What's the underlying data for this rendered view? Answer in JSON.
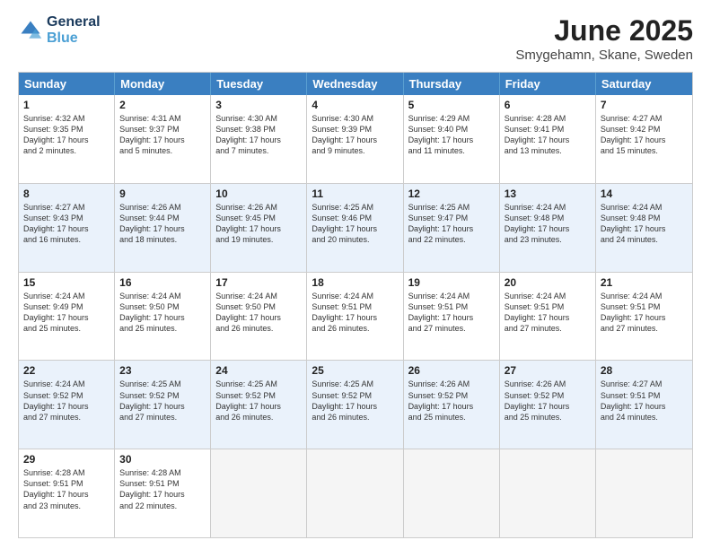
{
  "header": {
    "logo_line1": "General",
    "logo_line2": "Blue",
    "title": "June 2025",
    "subtitle": "Smygehamn, Skane, Sweden"
  },
  "calendar": {
    "days": [
      "Sunday",
      "Monday",
      "Tuesday",
      "Wednesday",
      "Thursday",
      "Friday",
      "Saturday"
    ],
    "rows": [
      [
        {
          "num": "1",
          "lines": [
            "Sunrise: 4:32 AM",
            "Sunset: 9:35 PM",
            "Daylight: 17 hours",
            "and 2 minutes."
          ]
        },
        {
          "num": "2",
          "lines": [
            "Sunrise: 4:31 AM",
            "Sunset: 9:37 PM",
            "Daylight: 17 hours",
            "and 5 minutes."
          ]
        },
        {
          "num": "3",
          "lines": [
            "Sunrise: 4:30 AM",
            "Sunset: 9:38 PM",
            "Daylight: 17 hours",
            "and 7 minutes."
          ]
        },
        {
          "num": "4",
          "lines": [
            "Sunrise: 4:30 AM",
            "Sunset: 9:39 PM",
            "Daylight: 17 hours",
            "and 9 minutes."
          ]
        },
        {
          "num": "5",
          "lines": [
            "Sunrise: 4:29 AM",
            "Sunset: 9:40 PM",
            "Daylight: 17 hours",
            "and 11 minutes."
          ]
        },
        {
          "num": "6",
          "lines": [
            "Sunrise: 4:28 AM",
            "Sunset: 9:41 PM",
            "Daylight: 17 hours",
            "and 13 minutes."
          ]
        },
        {
          "num": "7",
          "lines": [
            "Sunrise: 4:27 AM",
            "Sunset: 9:42 PM",
            "Daylight: 17 hours",
            "and 15 minutes."
          ]
        }
      ],
      [
        {
          "num": "8",
          "lines": [
            "Sunrise: 4:27 AM",
            "Sunset: 9:43 PM",
            "Daylight: 17 hours",
            "and 16 minutes."
          ]
        },
        {
          "num": "9",
          "lines": [
            "Sunrise: 4:26 AM",
            "Sunset: 9:44 PM",
            "Daylight: 17 hours",
            "and 18 minutes."
          ]
        },
        {
          "num": "10",
          "lines": [
            "Sunrise: 4:26 AM",
            "Sunset: 9:45 PM",
            "Daylight: 17 hours",
            "and 19 minutes."
          ]
        },
        {
          "num": "11",
          "lines": [
            "Sunrise: 4:25 AM",
            "Sunset: 9:46 PM",
            "Daylight: 17 hours",
            "and 20 minutes."
          ]
        },
        {
          "num": "12",
          "lines": [
            "Sunrise: 4:25 AM",
            "Sunset: 9:47 PM",
            "Daylight: 17 hours",
            "and 22 minutes."
          ]
        },
        {
          "num": "13",
          "lines": [
            "Sunrise: 4:24 AM",
            "Sunset: 9:48 PM",
            "Daylight: 17 hours",
            "and 23 minutes."
          ]
        },
        {
          "num": "14",
          "lines": [
            "Sunrise: 4:24 AM",
            "Sunset: 9:48 PM",
            "Daylight: 17 hours",
            "and 24 minutes."
          ]
        }
      ],
      [
        {
          "num": "15",
          "lines": [
            "Sunrise: 4:24 AM",
            "Sunset: 9:49 PM",
            "Daylight: 17 hours",
            "and 25 minutes."
          ]
        },
        {
          "num": "16",
          "lines": [
            "Sunrise: 4:24 AM",
            "Sunset: 9:50 PM",
            "Daylight: 17 hours",
            "and 25 minutes."
          ]
        },
        {
          "num": "17",
          "lines": [
            "Sunrise: 4:24 AM",
            "Sunset: 9:50 PM",
            "Daylight: 17 hours",
            "and 26 minutes."
          ]
        },
        {
          "num": "18",
          "lines": [
            "Sunrise: 4:24 AM",
            "Sunset: 9:51 PM",
            "Daylight: 17 hours",
            "and 26 minutes."
          ]
        },
        {
          "num": "19",
          "lines": [
            "Sunrise: 4:24 AM",
            "Sunset: 9:51 PM",
            "Daylight: 17 hours",
            "and 27 minutes."
          ]
        },
        {
          "num": "20",
          "lines": [
            "Sunrise: 4:24 AM",
            "Sunset: 9:51 PM",
            "Daylight: 17 hours",
            "and 27 minutes."
          ]
        },
        {
          "num": "21",
          "lines": [
            "Sunrise: 4:24 AM",
            "Sunset: 9:51 PM",
            "Daylight: 17 hours",
            "and 27 minutes."
          ]
        }
      ],
      [
        {
          "num": "22",
          "lines": [
            "Sunrise: 4:24 AM",
            "Sunset: 9:52 PM",
            "Daylight: 17 hours",
            "and 27 minutes."
          ]
        },
        {
          "num": "23",
          "lines": [
            "Sunrise: 4:25 AM",
            "Sunset: 9:52 PM",
            "Daylight: 17 hours",
            "and 27 minutes."
          ]
        },
        {
          "num": "24",
          "lines": [
            "Sunrise: 4:25 AM",
            "Sunset: 9:52 PM",
            "Daylight: 17 hours",
            "and 26 minutes."
          ]
        },
        {
          "num": "25",
          "lines": [
            "Sunrise: 4:25 AM",
            "Sunset: 9:52 PM",
            "Daylight: 17 hours",
            "and 26 minutes."
          ]
        },
        {
          "num": "26",
          "lines": [
            "Sunrise: 4:26 AM",
            "Sunset: 9:52 PM",
            "Daylight: 17 hours",
            "and 25 minutes."
          ]
        },
        {
          "num": "27",
          "lines": [
            "Sunrise: 4:26 AM",
            "Sunset: 9:52 PM",
            "Daylight: 17 hours",
            "and 25 minutes."
          ]
        },
        {
          "num": "28",
          "lines": [
            "Sunrise: 4:27 AM",
            "Sunset: 9:51 PM",
            "Daylight: 17 hours",
            "and 24 minutes."
          ]
        }
      ],
      [
        {
          "num": "29",
          "lines": [
            "Sunrise: 4:28 AM",
            "Sunset: 9:51 PM",
            "Daylight: 17 hours",
            "and 23 minutes."
          ]
        },
        {
          "num": "30",
          "lines": [
            "Sunrise: 4:28 AM",
            "Sunset: 9:51 PM",
            "Daylight: 17 hours",
            "and 22 minutes."
          ]
        },
        {
          "num": "",
          "lines": []
        },
        {
          "num": "",
          "lines": []
        },
        {
          "num": "",
          "lines": []
        },
        {
          "num": "",
          "lines": []
        },
        {
          "num": "",
          "lines": []
        }
      ]
    ]
  }
}
